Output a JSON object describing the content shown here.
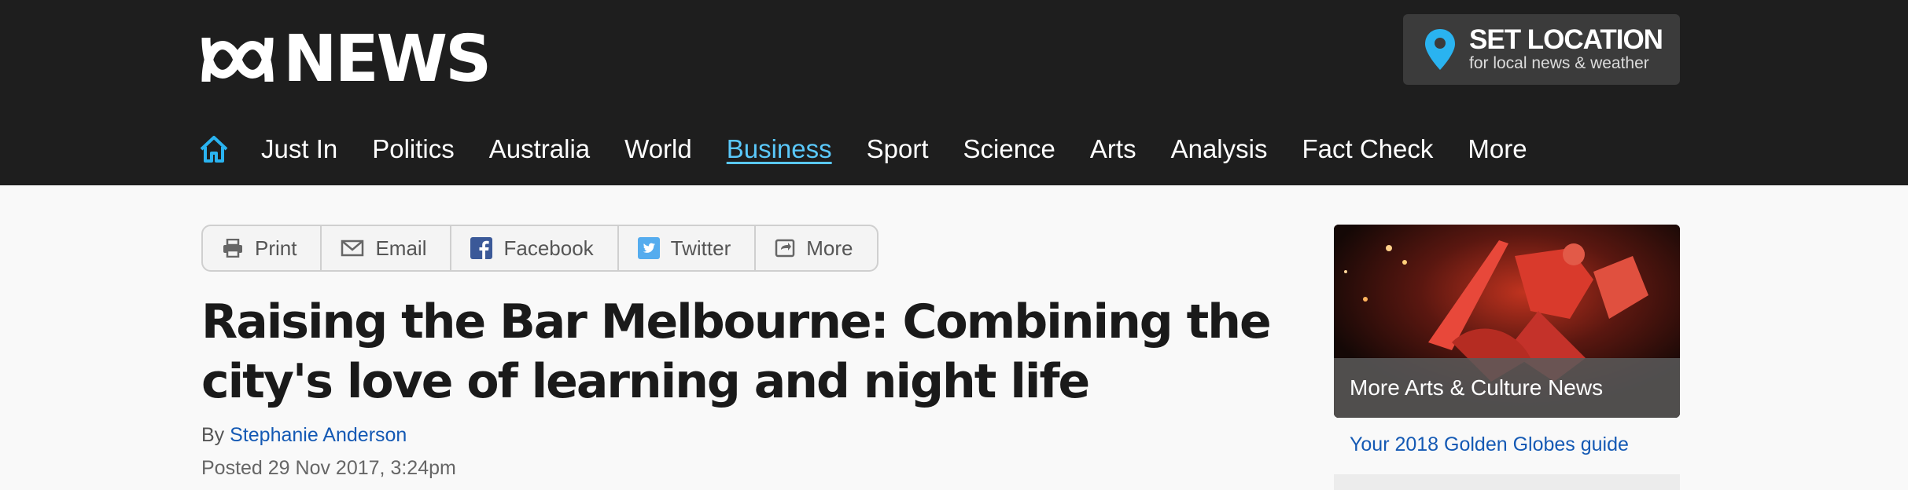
{
  "header": {
    "logo_text": "NEWS",
    "location": {
      "title": "SET LOCATION",
      "subtitle": "for local news & weather",
      "icon": "location-pin-icon"
    }
  },
  "nav": {
    "home_icon": "home-icon",
    "items": [
      {
        "label": "Just In"
      },
      {
        "label": "Politics"
      },
      {
        "label": "Australia"
      },
      {
        "label": "World"
      },
      {
        "label": "Business",
        "active": true
      },
      {
        "label": "Sport"
      },
      {
        "label": "Science"
      },
      {
        "label": "Arts"
      },
      {
        "label": "Analysis"
      },
      {
        "label": "Fact Check"
      },
      {
        "label": "More"
      }
    ]
  },
  "share": {
    "print": "Print",
    "email": "Email",
    "facebook": "Facebook",
    "twitter": "Twitter",
    "more": "More"
  },
  "article": {
    "headline": "Raising the Bar Melbourne: Combining the city's love of learning and night life",
    "by_label": "By",
    "author": "Stephanie Anderson",
    "posted": "Posted 29 Nov 2017, 3:24pm"
  },
  "sidebar": {
    "promo_caption": "More Arts & Culture News",
    "link": "Your 2018 Golden Globes guide"
  },
  "colors": {
    "header_bg": "#1e1e1e",
    "accent": "#5ac8fa",
    "link": "#1459b4",
    "page_bg": "#f9f9f9"
  }
}
